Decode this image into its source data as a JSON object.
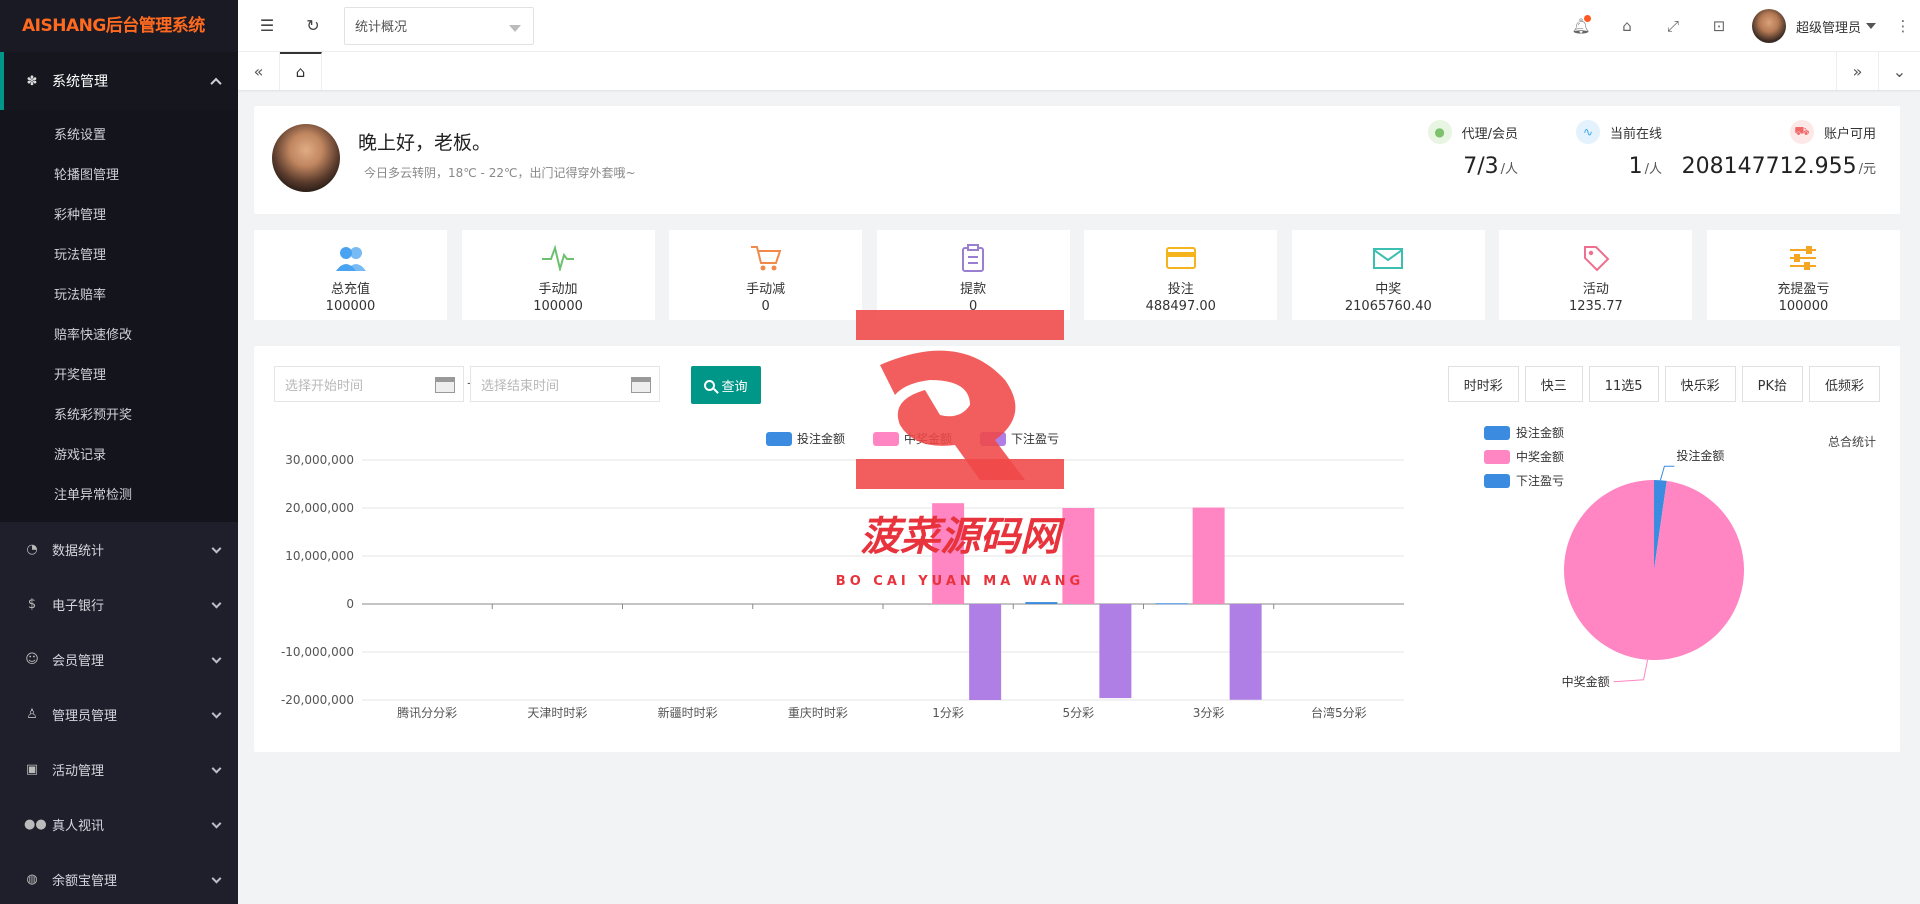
{
  "app": {
    "title": "AISHANG后台管理系统"
  },
  "sidebar": {
    "active_group": {
      "label": "系统管理",
      "icon": "gear-icon"
    },
    "sub_items": [
      "系统设置",
      "轮播图管理",
      "彩种管理",
      "玩法管理",
      "玩法赔率",
      "赔率快速修改",
      "开奖管理",
      "系统彩预开奖",
      "游戏记录",
      "注单异常检测"
    ],
    "groups": [
      {
        "label": "数据统计",
        "icon": "dashboard-icon"
      },
      {
        "label": "电子银行",
        "icon": "dollar-icon"
      },
      {
        "label": "会员管理",
        "icon": "user-icon"
      },
      {
        "label": "管理员管理",
        "icon": "person-icon"
      },
      {
        "label": "活动管理",
        "icon": "gift-icon"
      },
      {
        "label": "真人视讯",
        "icon": "users-icon"
      },
      {
        "label": "余额宝管理",
        "icon": "wallet-icon"
      }
    ]
  },
  "topbar": {
    "page_select": "统计概况",
    "user_name": "超级管理员"
  },
  "welcome": {
    "greeting": "晚上好，老板。",
    "weather": "今日多云转阴，18℃ - 22℃，出门记得穿外套哦~"
  },
  "header_stats": [
    {
      "label": "代理/会员",
      "value": "7/3",
      "unit": "/人",
      "color": "#7cc26b",
      "icon": "users-icon"
    },
    {
      "label": "当前在线",
      "value": "1",
      "unit": "/人",
      "color": "#3ba7e8",
      "icon": "pulse-icon"
    },
    {
      "label": "账户可用",
      "value": "208147712.955",
      "unit": "/元",
      "color": "#f06767",
      "icon": "cart-icon"
    }
  ],
  "kpis": [
    {
      "label": "总充值",
      "value": "100000",
      "color": "#4aa3f0",
      "icon": "users-icon"
    },
    {
      "label": "手动加",
      "value": "100000",
      "color": "#6cc070",
      "icon": "pulse-icon"
    },
    {
      "label": "手动减",
      "value": "0",
      "color": "#f08a4b",
      "icon": "cart-icon"
    },
    {
      "label": "提款",
      "value": "0",
      "color": "#9a7fd0",
      "icon": "clipboard-icon"
    },
    {
      "label": "投注",
      "value": "488497.00",
      "color": "#f5b31e",
      "icon": "card-icon"
    },
    {
      "label": "中奖",
      "value": "21065760.40",
      "color": "#3cbfb0",
      "icon": "mail-icon"
    },
    {
      "label": "活动",
      "value": "1235.77",
      "color": "#f06e8e",
      "icon": "tag-icon"
    },
    {
      "label": "充提盈亏",
      "value": "100000",
      "color": "#f5a623",
      "icon": "sliders-icon"
    }
  ],
  "query": {
    "start_placeholder": "选择开始时间",
    "end_placeholder": "选择结束时间",
    "button": "查询",
    "dash": "-"
  },
  "filters": [
    "时时彩",
    "快三",
    "11选5",
    "快乐彩",
    "PK拾",
    "低频彩"
  ],
  "chart_data": [
    {
      "type": "bar",
      "categories": [
        "腾讯分分彩",
        "天津时时彩",
        "新疆时时彩",
        "重庆时时彩",
        "1分彩",
        "5分彩",
        "3分彩",
        "台湾5分彩"
      ],
      "series": [
        {
          "name": "投注金额",
          "color": "#3b8be0",
          "values": [
            0,
            0,
            0,
            0,
            0,
            400000,
            150000,
            0
          ]
        },
        {
          "name": "中奖金额",
          "color": "#ff86c2",
          "values": [
            0,
            0,
            0,
            0,
            21000000,
            20000000,
            20100000,
            0
          ]
        },
        {
          "name": "下注盈亏",
          "color": "#b07fe6",
          "values": [
            0,
            0,
            0,
            0,
            -20000000,
            -19600000,
            -19950000,
            0
          ]
        }
      ],
      "ylim": [
        -20000000,
        30000000
      ],
      "yticks": [
        "30,000,000",
        "20,000,000",
        "10,000,000",
        "0",
        "-10,000,000",
        "-20,000,000"
      ],
      "legend_placement": "top"
    },
    {
      "type": "pie",
      "title": "总合统计",
      "legend": [
        {
          "name": "投注金额",
          "color": "#3b8be0"
        },
        {
          "name": "中奖金额",
          "color": "#ff86c2"
        },
        {
          "name": "下注盈亏",
          "color": "#3b8be0"
        }
      ],
      "slices": [
        {
          "name": "投注金额",
          "value": 488497.0,
          "color": "#3b8be0"
        },
        {
          "name": "中奖金额",
          "value": 21065760.4,
          "color": "#ff86c2"
        }
      ]
    }
  ],
  "watermark": {
    "title": "菠菜源码网",
    "subtitle": "BO CAI YUAN MA WANG"
  }
}
